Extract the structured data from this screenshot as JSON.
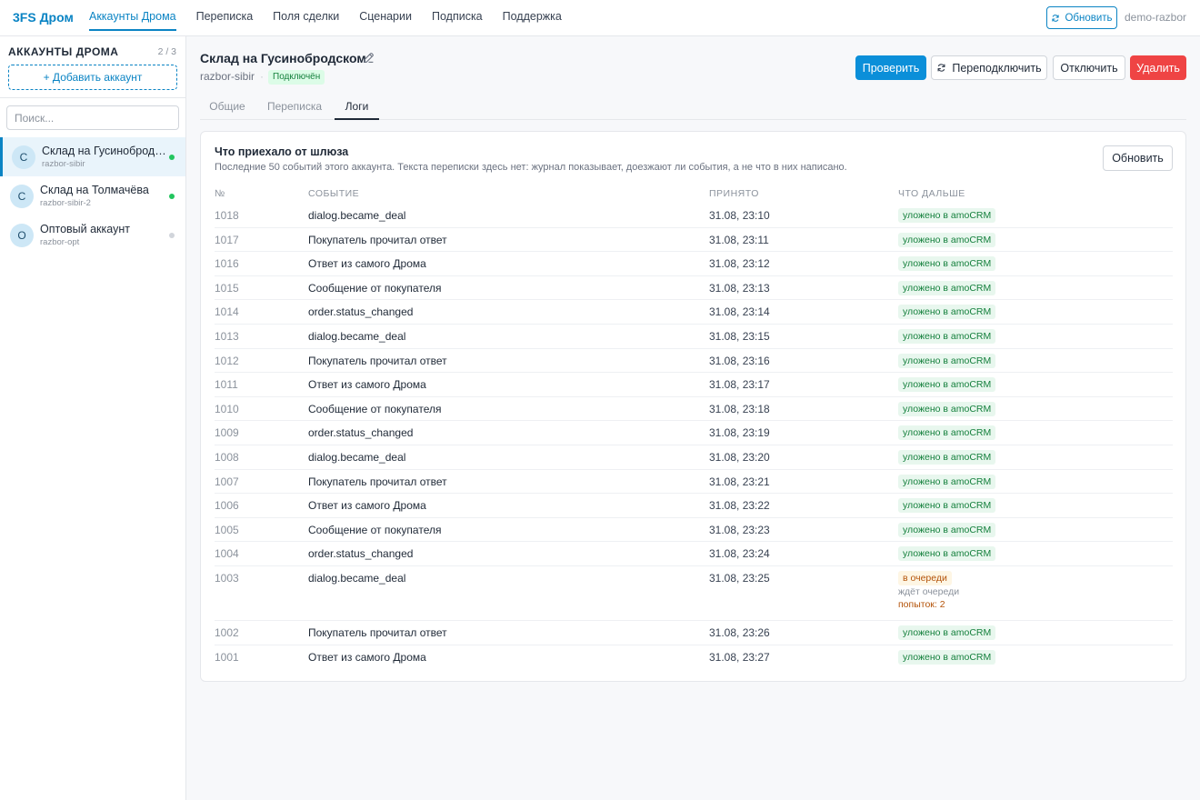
{
  "app": {
    "brand": "3FS Дром",
    "nav": [
      "Аккаунты Дрома",
      "Переписка",
      "Поля сделки",
      "Сценарии",
      "Подписка",
      "Поддержка"
    ],
    "refresh_label": "Обновить",
    "user": "demo-razbor"
  },
  "sidebar": {
    "title": "АККАУНТЫ ДРОМА",
    "count": "2 / 3",
    "add_label": "+ Добавить аккаунт",
    "search_placeholder": "Поиск...",
    "accounts": [
      {
        "initial": "С",
        "name": "Склад на Гусинобродском",
        "login": "razbor-sibir",
        "online": true
      },
      {
        "initial": "С",
        "name": "Склад на Толмачёва",
        "login": "razbor-sibir-2",
        "online": true
      },
      {
        "initial": "О",
        "name": "Оптовый аккаунт",
        "login": "razbor-opt",
        "online": false
      }
    ]
  },
  "account": {
    "title": "Склад на Гусинобродском",
    "login": "razbor-sibir",
    "separator": "·",
    "status": "Подключён",
    "actions": {
      "check": "Проверить",
      "reconnect": "Переподключить",
      "disconnect": "Отключить",
      "delete": "Удалить"
    },
    "tabs": [
      "Общие",
      "Переписка",
      "Логи"
    ]
  },
  "logs": {
    "title": "Что приехало от шлюза",
    "subtitle": "Последние 50 событий этого аккаунта. Текста переписки здесь нет: журнал показывает, доезжают ли события, а не что в них написано.",
    "refresh_label": "Обновить",
    "columns": [
      "№",
      "Событие",
      "Принято",
      "Что дальше"
    ],
    "rows": [
      {
        "id": "1018",
        "event": "dialog.became_deal",
        "time": "31.08, 23:10",
        "status": "уложено в amoCRM"
      },
      {
        "id": "1017",
        "event": "Покупатель прочитал ответ",
        "time": "31.08, 23:11",
        "status": "уложено в amoCRM"
      },
      {
        "id": "1016",
        "event": "Ответ из самого Дрома",
        "time": "31.08, 23:12",
        "status": "уложено в amoCRM"
      },
      {
        "id": "1015",
        "event": "Сообщение от покупателя",
        "time": "31.08, 23:13",
        "status": "уложено в amoCRM"
      },
      {
        "id": "1014",
        "event": "order.status_changed",
        "time": "31.08, 23:14",
        "status": "уложено в amoCRM"
      },
      {
        "id": "1013",
        "event": "dialog.became_deal",
        "time": "31.08, 23:15",
        "status": "уложено в amoCRM"
      },
      {
        "id": "1012",
        "event": "Покупатель прочитал ответ",
        "time": "31.08, 23:16",
        "status": "уложено в amoCRM"
      },
      {
        "id": "1011",
        "event": "Ответ из самого Дрома",
        "time": "31.08, 23:17",
        "status": "уложено в amoCRM"
      },
      {
        "id": "1010",
        "event": "Сообщение от покупателя",
        "time": "31.08, 23:18",
        "status": "уложено в amoCRM"
      },
      {
        "id": "1009",
        "event": "order.status_changed",
        "time": "31.08, 23:19",
        "status": "уложено в amoCRM"
      },
      {
        "id": "1008",
        "event": "dialog.became_deal",
        "time": "31.08, 23:20",
        "status": "уложено в amoCRM"
      },
      {
        "id": "1007",
        "event": "Покупатель прочитал ответ",
        "time": "31.08, 23:21",
        "status": "уложено в amoCRM"
      },
      {
        "id": "1006",
        "event": "Ответ из самого Дрома",
        "time": "31.08, 23:22",
        "status": "уложено в amoCRM"
      },
      {
        "id": "1005",
        "event": "Сообщение от покупателя",
        "time": "31.08, 23:23",
        "status": "уложено в amoCRM"
      },
      {
        "id": "1004",
        "event": "order.status_changed",
        "time": "31.08, 23:24",
        "status": "уложено в amoCRM"
      },
      {
        "id": "1003",
        "event": "dialog.became_deal",
        "time": "31.08, 23:25",
        "status": "в очереди",
        "note": "ждёт очереди",
        "tries": "попыток: 2"
      },
      {
        "id": "1002",
        "event": "Покупатель прочитал ответ",
        "time": "31.08, 23:26",
        "status": "уложено в amoCRM"
      },
      {
        "id": "1001",
        "event": "Ответ из самого Дрома",
        "time": "31.08, 23:27",
        "status": "уложено в amoCRM"
      }
    ]
  },
  "colors": {
    "accent": "#0b84c4",
    "primary": "#0b8fd9",
    "danger": "#ef4444",
    "success": "#15803d",
    "warning": "#b45309"
  },
  "icons": {
    "refresh": "refresh-icon",
    "edit": "pencil-icon",
    "online": "status-dot-icon"
  }
}
